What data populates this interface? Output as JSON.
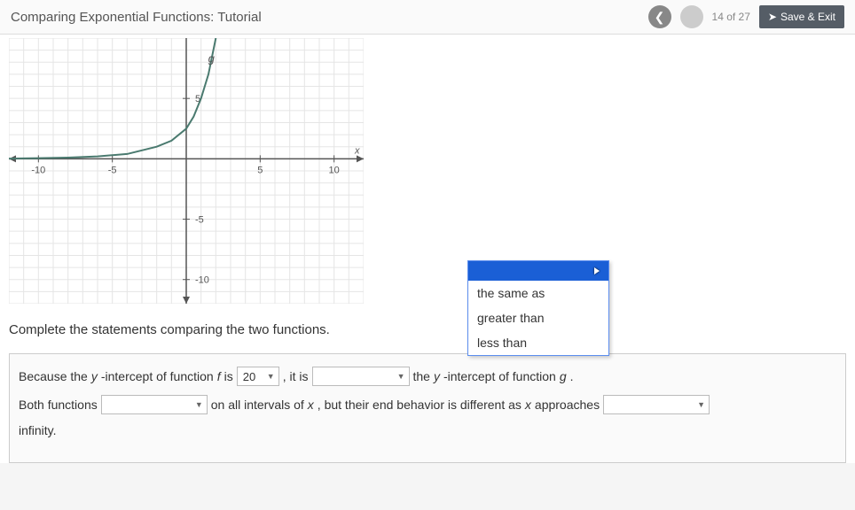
{
  "header": {
    "title": "Comparing Exponential Functions: Tutorial",
    "progress": "14 of 27",
    "save_exit": "Save & Exit"
  },
  "prompt": "Complete the statements comparing the two functions.",
  "dropdown_options": {
    "opt1": "the same as",
    "opt2": "greater than",
    "opt3": "less than"
  },
  "line1": {
    "part1": "Because the ",
    "yint": "y",
    "part1b": "-intercept of function ",
    "f": "f",
    "part1c": " is",
    "sel_value": "20",
    "part2": ", it is",
    "part3": "the ",
    "yint2": "y",
    "part3b": "-intercept of function ",
    "g": "g",
    "part3c": "."
  },
  "line2": {
    "part1": "Both functions",
    "part2": "on all intervals of ",
    "x": "x",
    "part2b": ", but their end behavior is different as ",
    "x2": "x",
    "part2c": " approaches",
    "part3": "infinity."
  },
  "chart_data": {
    "type": "line",
    "title": "",
    "xlabel": "x",
    "ylabel": "",
    "xlim": [
      -12,
      12
    ],
    "ylim": [
      -12,
      10
    ],
    "xticks": [
      -10,
      -5,
      5,
      10
    ],
    "yticks": [
      -10,
      -5,
      5
    ],
    "function_label": "g",
    "series": [
      {
        "name": "g",
        "x": [
          -12,
          -10,
          -8,
          -6,
          -4,
          -2,
          -1,
          0,
          0.5,
          1,
          1.5,
          2
        ],
        "y": [
          0.02,
          0.05,
          0.1,
          0.2,
          0.4,
          1,
          1.5,
          2.5,
          3.5,
          5,
          7,
          10
        ]
      }
    ]
  }
}
